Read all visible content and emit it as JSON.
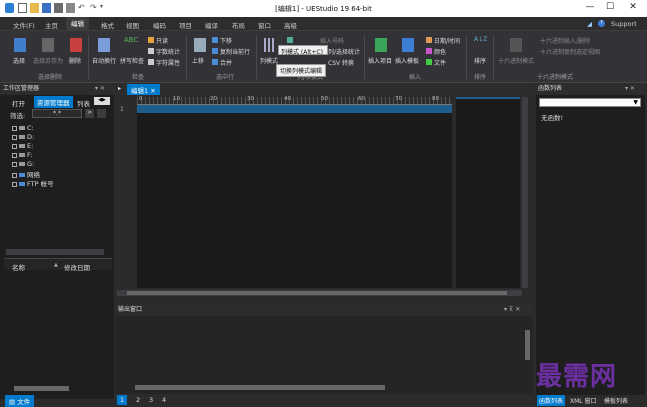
{
  "titlebar": {
    "title": "[编辑1] - UEStudio 19 64-bit",
    "minimize": "—",
    "maximize": "☐",
    "close": "✕"
  },
  "menubar": {
    "items": [
      "文件(F)",
      "主页",
      "编辑",
      "格式",
      "视图",
      "编码",
      "项目",
      "编译",
      "布局",
      "窗口",
      "高级"
    ],
    "active_index": 2,
    "help": "?",
    "support": "Support"
  },
  "ribbon": {
    "select": "选择",
    "select_all_as": "选择另存为",
    "delete": "删除",
    "group_select_delete": "选择删除",
    "autowrap": "自动换行",
    "spellcheck": "拼写检查",
    "readonly": "只读",
    "word_stats": "字数统计",
    "char_props": "字符属性",
    "group_check": "检查",
    "move_up": "上移",
    "move_down": "下移",
    "copy_line": "复制当前行",
    "merge": "合并",
    "group_line_ops": "选中行",
    "column_mode": "列模式",
    "insert_number": "插入号码",
    "column_select_stats": "列/选择统计",
    "csv_convert": "CSV 转换",
    "group_column": "列/块模式",
    "tooltip_title": "列模式 (Alt+C)",
    "tooltip_desc": "切换列模式编辑",
    "insert_item": "插入项目",
    "insert_template": "插入模板",
    "date_time": "日期/时间",
    "color": "颜色",
    "file": "文件",
    "group_insert": "插入",
    "sort": "排序",
    "group_sort": "排序",
    "hex_mode": "十六进制模式",
    "hex_insert_delete": "十六进制插入/删除",
    "hex_copy_selection": "十六进制复制选定视图",
    "group_hex": "十六进制模式"
  },
  "left_panel": {
    "title": "工作区管理器",
    "tabs": [
      "打开",
      "资源管理器",
      "列表"
    ],
    "filter_label": "筛选:",
    "filter_value": "*.*",
    "tree": [
      {
        "label": "C:",
        "icon": "drive-icon"
      },
      {
        "label": "D:",
        "icon": "drive-icon"
      },
      {
        "label": "E:",
        "icon": "drive-icon"
      },
      {
        "label": "F:",
        "icon": "drive-icon"
      },
      {
        "label": "G:",
        "icon": "drive-icon"
      },
      {
        "label": "网络",
        "icon": "network-icon"
      },
      {
        "label": "FTP 帐号",
        "icon": "ftp-icon"
      }
    ],
    "col_name": "名称",
    "col_date": "修改日期",
    "bottom_tab": "文件"
  },
  "editor": {
    "tab_label": "编辑1",
    "ruler_marks": [
      "0",
      "10",
      "20",
      "30",
      "40",
      "50",
      "60",
      "70",
      "80"
    ],
    "line_number": "1"
  },
  "output": {
    "title": "输出窗口",
    "tabs": [
      "1",
      "2",
      "3",
      "4"
    ]
  },
  "right_panel": {
    "title": "函数列表",
    "empty_text": "无函数!",
    "bottom_tabs": [
      "函数列表",
      "XML 窗口",
      "模板列表"
    ],
    "watermark": "最需网"
  },
  "colors": {
    "accent": "#007acc",
    "bg": "#2b2b2b",
    "editor_bg": "#1e1e1e"
  }
}
